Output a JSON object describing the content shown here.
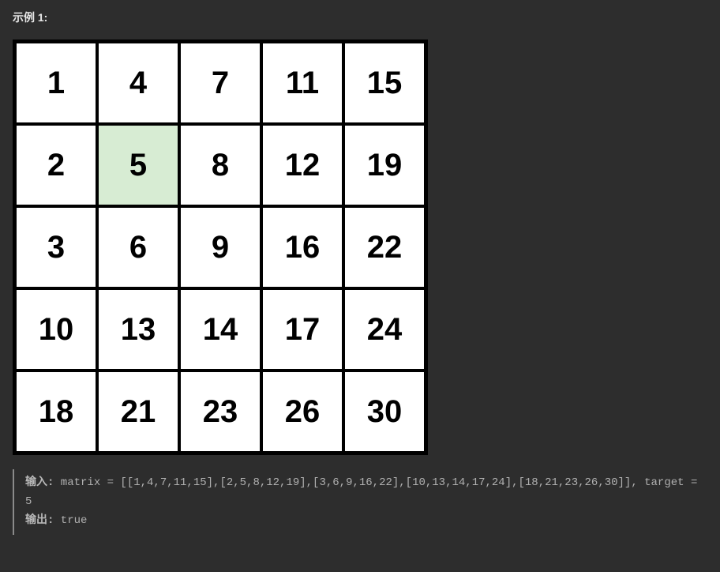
{
  "example_title": "示例 1:",
  "matrix": [
    [
      1,
      4,
      7,
      11,
      15
    ],
    [
      2,
      5,
      8,
      12,
      19
    ],
    [
      3,
      6,
      9,
      16,
      22
    ],
    [
      10,
      13,
      14,
      17,
      24
    ],
    [
      18,
      21,
      23,
      26,
      30
    ]
  ],
  "target": 5,
  "highlighted_cell": {
    "row": 1,
    "col": 1
  },
  "code": {
    "input_label": "输入:",
    "input_text": " matrix = [[1,4,7,11,15],[2,5,8,12,19],[3,6,9,16,22],[10,13,14,17,24],[18,21,23,26,30]], target = 5",
    "output_label": "输出:",
    "output_text": " true"
  }
}
